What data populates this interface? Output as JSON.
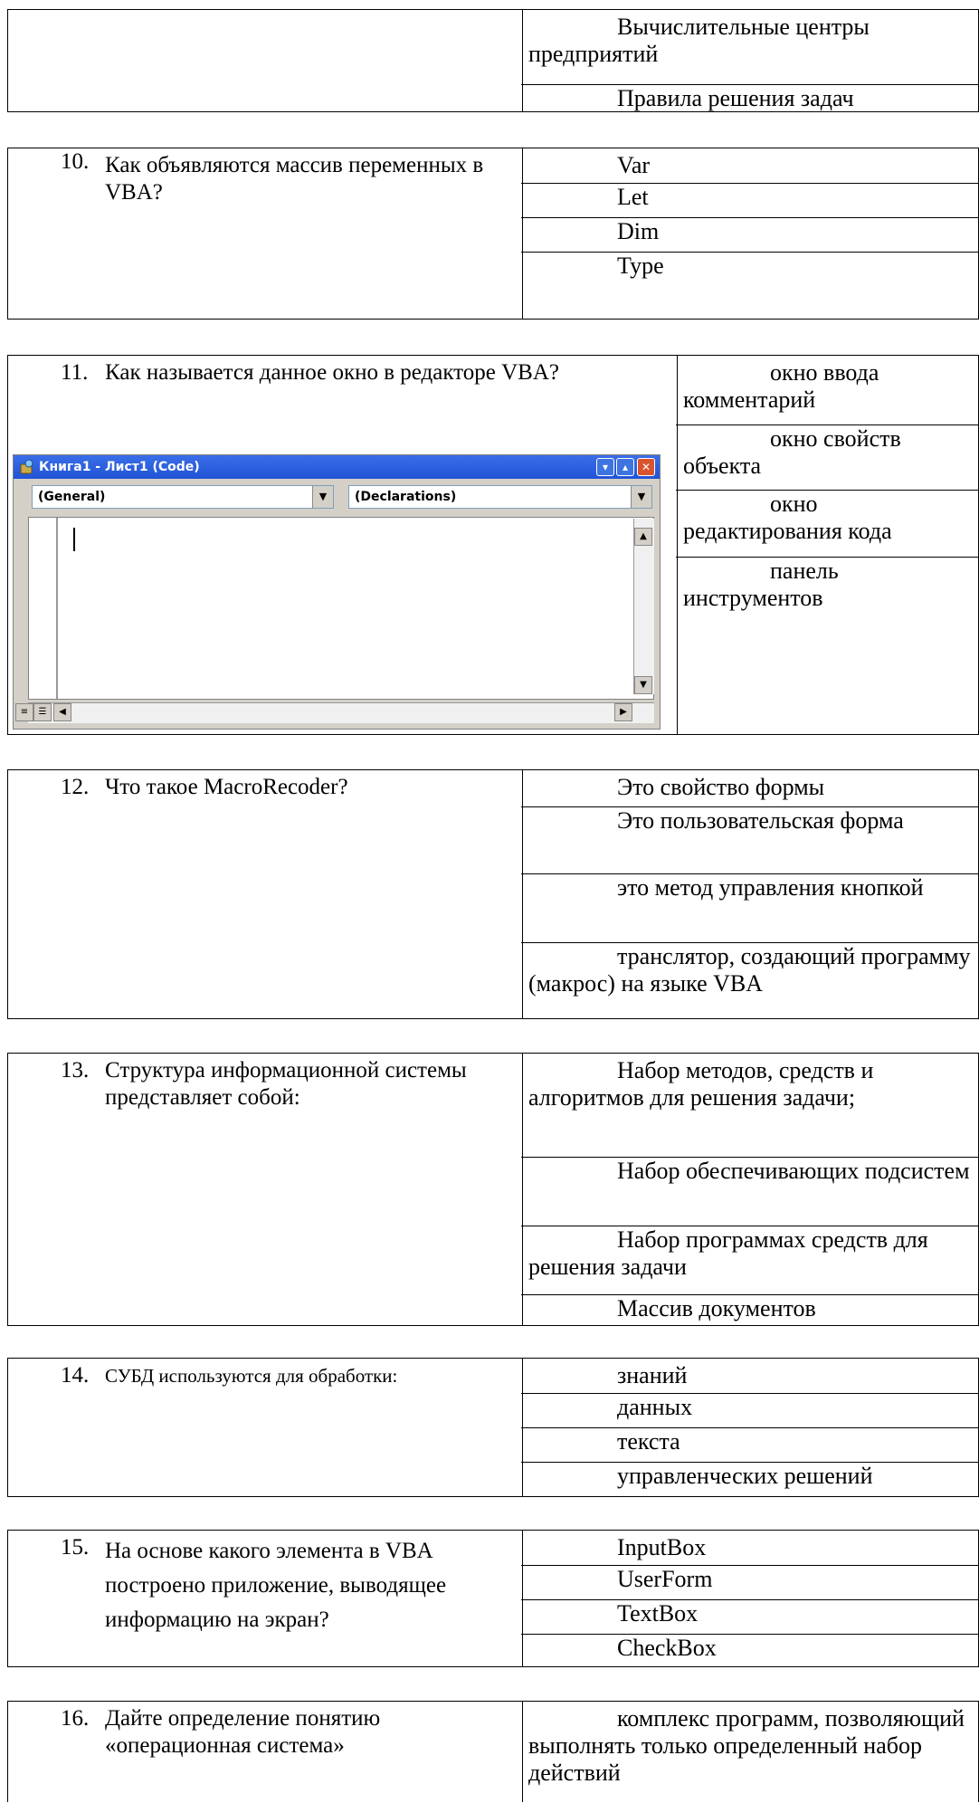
{
  "block0": {
    "options": [
      "Вычислительные центры предприятий",
      "Правила решения задач"
    ]
  },
  "q10": {
    "number": "10.",
    "text": "Как объявляются массив переменных в VBA?",
    "options": [
      "Var",
      "Let",
      "Dim",
      "Type"
    ]
  },
  "q11": {
    "number": "11.",
    "text": "Как называется данное окно в редакторе VBA?",
    "options": [
      "окно ввода комментарий",
      "окно свойств объекта",
      "окно редактирования кода",
      "панель инструментов"
    ],
    "window": {
      "title": "Книга1 - Лист1 (Code)",
      "left_combo": "(General)",
      "right_combo": "(Declarations)",
      "icon": "vba-module-icon"
    }
  },
  "q12": {
    "number": "12.",
    "text": "Что такое MacroRecoder?",
    "options": [
      "Это свойство формы",
      "Это пользовательская форма",
      "это метод управления кнопкой",
      "транслятор, создающий программу (макрос) на языке VBA"
    ]
  },
  "q13": {
    "number": "13.",
    "text": "Структура информационной системы представляет собой:",
    "options": [
      "Набор методов, средств и алгоритмов для решения задачи;",
      "Набор обеспечивающих подсистем",
      "Набор программах средств для решения задачи",
      "Массив документов"
    ]
  },
  "q14": {
    "number": "14.",
    "text": "СУБД используются для обработки:",
    "options": [
      "знаний",
      "данных",
      "текста",
      "управленческих решений"
    ]
  },
  "q15": {
    "number": "15.",
    "text": "На основе какого элемента в VBA построено приложение, выводящее информацию на экран?",
    "options": [
      "InputBox",
      "UserForm",
      "TextBox",
      "CheckBox"
    ]
  },
  "q16": {
    "number": "16.",
    "text": "Дайте определение понятию «операционная система»",
    "options": [
      "комплекс программ, позволяющий выполнять только определенный набор действий"
    ]
  }
}
